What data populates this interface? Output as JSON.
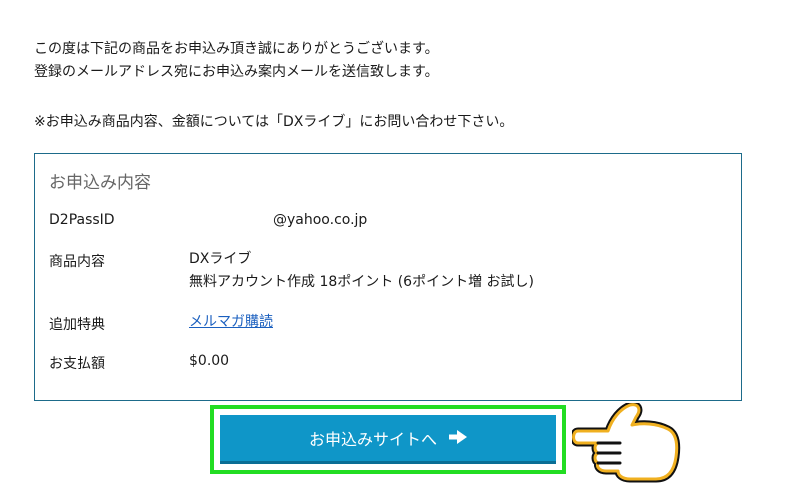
{
  "intro": {
    "line1": "この度は下記の商品をお申込み頂き誠にありがとうございます。",
    "line2": "登録のメールアドレス宛にお申込み案内メールを送信致します。"
  },
  "note": "※お申込み商品内容、金額については「DXライブ」にお問い合わせ下さい。",
  "details": {
    "title": "お申込み内容",
    "rows": [
      {
        "label": "D2PassID",
        "value": "@yahoo.co.jp"
      },
      {
        "label": "商品内容",
        "value": "DXライブ",
        "value2": "無料アカウント作成 18ポイント (6ポイント増 お試し)"
      },
      {
        "label": "追加特典",
        "value": "メルマガ購読"
      },
      {
        "label": "お支払額",
        "value": "$0.00"
      }
    ]
  },
  "button": {
    "label": "お申込みサイトへ",
    "icon": "arrow-right-icon"
  },
  "colors": {
    "button": "#0f96c8",
    "highlight": "#22dd22",
    "box_border": "#1d6b8a",
    "hand": "#f0b020"
  },
  "pointer_icon": "pointing-hand-icon"
}
